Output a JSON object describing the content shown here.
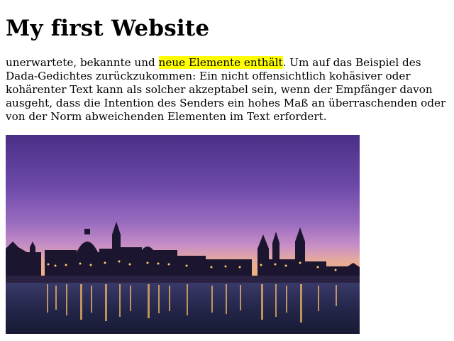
{
  "page": {
    "title": "My first Website",
    "paragraph": {
      "before_highlight": "unerwartete, bekannte und ",
      "highlight": "neue Elemente enthält",
      "after_highlight": ". Um auf das Beispiel des Dada-Gedichtes zurückzukommen: Ein nicht offensichtlich kohäsiver oder kohärenter Text kann als solcher akzeptabel sein, wenn der Empfänger davon ausgeht, dass die Intention des Senders ein hohes Maß an überraschenden oder von der Norm abweichenden Elementen im Text erfordert."
    },
    "highlight_color": "#ffff00",
    "image": {
      "subject": "dresden-skyline-night-photo"
    }
  }
}
